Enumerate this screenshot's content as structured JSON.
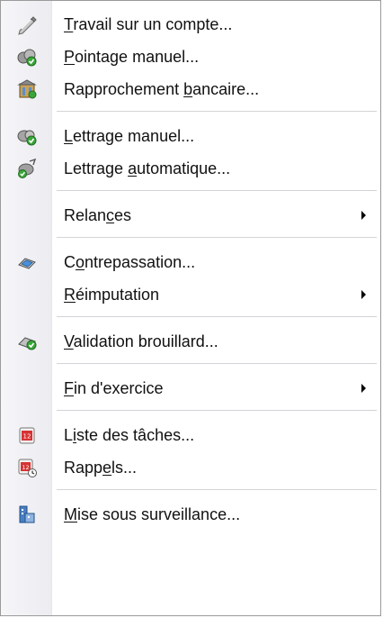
{
  "menu": {
    "items": [
      {
        "pre": "",
        "acc": "T",
        "post": "ravail sur un compte...",
        "icon": "pencil-icon"
      },
      {
        "pre": "",
        "acc": "P",
        "post": "ointage manuel...",
        "icon": "check-binoculars-icon"
      },
      {
        "pre": "Rapprochement ",
        "acc": "b",
        "post": "ancaire...",
        "icon": "bank-building-icon"
      },
      {
        "pre": "",
        "acc": "L",
        "post": "ettrage manuel...",
        "icon": "manual-match-icon"
      },
      {
        "pre": "Lettrage ",
        "acc": "a",
        "post": "utomatique...",
        "icon": "auto-match-icon"
      },
      {
        "pre": "Relan",
        "acc": "c",
        "post": "es",
        "icon": ""
      },
      {
        "pre": "C",
        "acc": "o",
        "post": "ntrepassation...",
        "icon": "reverse-entry-icon"
      },
      {
        "pre": "",
        "acc": "R",
        "post": "éimputation",
        "icon": ""
      },
      {
        "pre": "",
        "acc": "V",
        "post": "alidation brouillard...",
        "icon": "validate-check-icon"
      },
      {
        "pre": "",
        "acc": "F",
        "post": "in d'exercice",
        "icon": ""
      },
      {
        "pre": "L",
        "acc": "i",
        "post": "ste des tâches...",
        "icon": "calendar-tasks-icon"
      },
      {
        "pre": "Rapp",
        "acc": "e",
        "post": "ls...",
        "icon": "calendar-reminder-icon"
      },
      {
        "pre": "",
        "acc": "M",
        "post": "ise sous surveillance...",
        "icon": "surveillance-icon"
      }
    ]
  },
  "colors": {
    "gutter": "#ececf1",
    "separator": "#d4d4d8",
    "text": "#111111"
  }
}
